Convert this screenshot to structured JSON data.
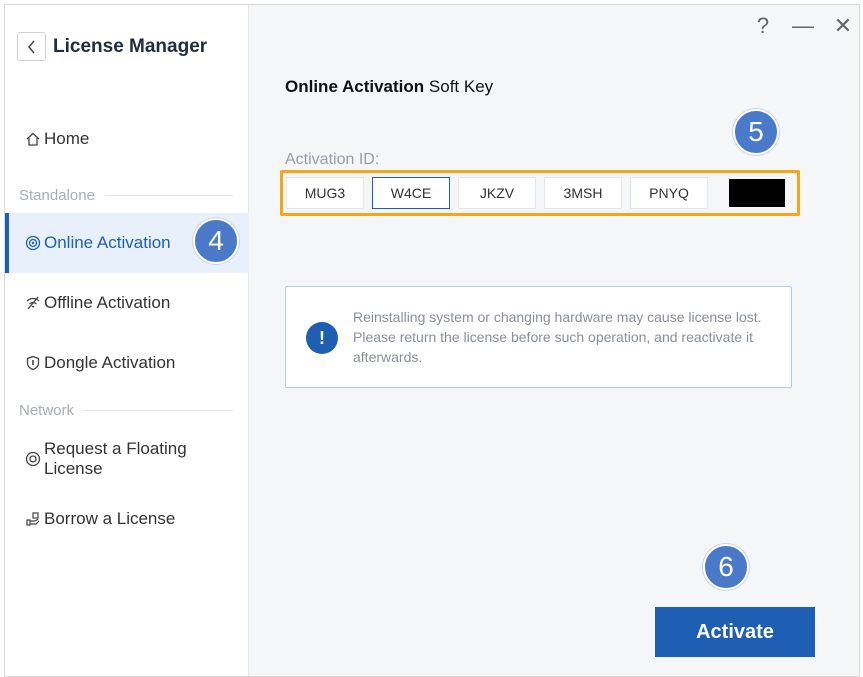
{
  "app": {
    "title": "License Manager"
  },
  "window_controls": {
    "help": "?",
    "minimize": "—",
    "close": "✕"
  },
  "sidebar": {
    "home": "Home",
    "section_standalone": "Standalone",
    "online_activation": "Online Activation",
    "offline_activation": "Offline Activation",
    "dongle_activation": "Dongle Activation",
    "section_network": "Network",
    "request_floating": "Request a Floating License",
    "borrow_license": "Borrow a License"
  },
  "main": {
    "heading_bold": "Online Activation",
    "heading_rest": " Soft Key",
    "activation_label": "Activation ID:",
    "activation_segments": [
      "MUG3",
      "W4CE",
      "JKZV",
      "3MSH",
      "PNYQ",
      ""
    ],
    "notice": "Reinstalling system or changing hardware may cause license lost. Please return the license before such operation, and reactivate it afterwards.",
    "notice_icon": "!",
    "activate_label": "Activate"
  },
  "badges": {
    "step4": "4",
    "step5": "5",
    "step6": "6"
  },
  "colors": {
    "accent": "#1f5fb3",
    "highlight_box": "#f0a71a",
    "badge": "#4a79c9"
  }
}
